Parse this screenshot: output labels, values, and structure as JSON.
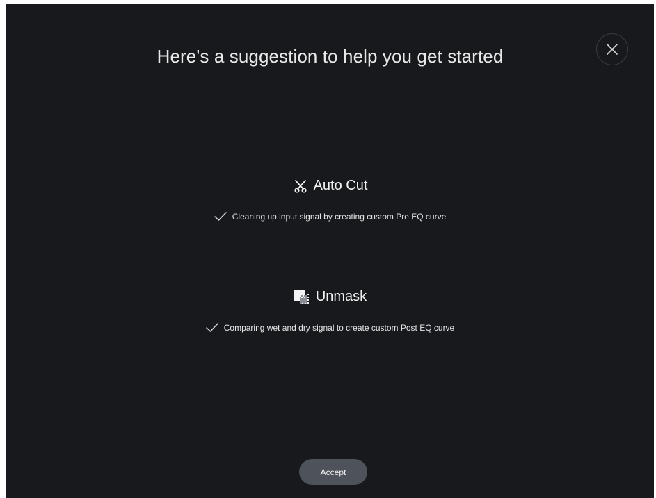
{
  "title": "Here's a suggestion to help you get started",
  "close_icon": "close-icon",
  "suggestions": [
    {
      "icon": "scissors-icon",
      "title": "Auto Cut",
      "check_icon": "check-icon",
      "detail": "Cleaning up input signal by creating custom Pre EQ curve"
    },
    {
      "icon": "unmask-icon",
      "title": "Unmask",
      "check_icon": "check-icon",
      "detail": "Comparing wet and dry signal to create custom Post EQ curve"
    }
  ],
  "accept_label": "Accept",
  "colors": {
    "dialog_background": "#17191d",
    "button_background": "#4e535b",
    "divider": "#3a3d43"
  }
}
